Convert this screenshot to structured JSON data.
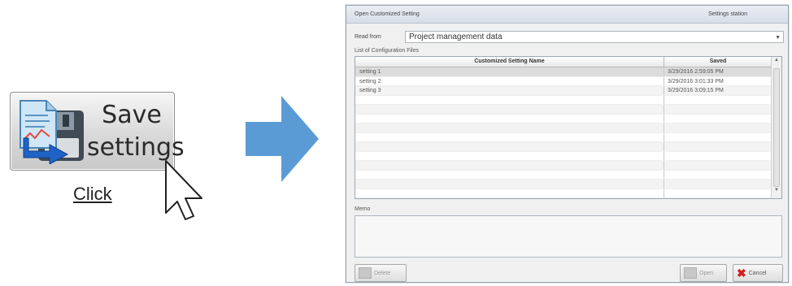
{
  "save_button": {
    "line1": "Save",
    "line2": "settings",
    "icon": "save-settings-icon"
  },
  "click_label": "Click",
  "dialog": {
    "title": "Open Customized Setting",
    "title_right": "Settings station",
    "read_from_label": "Read from",
    "read_from_value": "Project management data",
    "list_title": "List of Configuration Files",
    "columns": {
      "name": "Customized Setting Name",
      "saved": "Saved"
    },
    "rows": [
      {
        "name": "setting 1",
        "saved": "3/29/2016 2:59:05 PM"
      },
      {
        "name": "setting 2",
        "saved": "3/29/2016 3:01:33 PM"
      },
      {
        "name": "setting 3",
        "saved": "3/29/2016 3:09:15 PM"
      }
    ],
    "memo_label": "Memo",
    "delete_label": "Delete",
    "open_label": "Open",
    "cancel_label": "Cancel"
  }
}
